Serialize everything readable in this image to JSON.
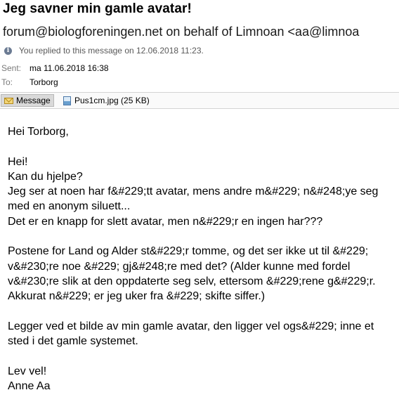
{
  "subject": "Jeg savner min gamle avatar!",
  "from": "forum@biologforeningen.net on behalf of Limnoan <aa@limnoa",
  "reply_notice": "You replied to this message on 12.06.2018 11:23.",
  "meta": {
    "sent_label": "Sent:",
    "sent_value": "ma 11.06.2018 16:38",
    "to_label": "To:",
    "to_value": "Torborg"
  },
  "attachments": {
    "message_tab": "Message",
    "file": "Pus1cm.jpg (25 KB)"
  },
  "body": {
    "greeting": "Hei Torborg,",
    "paragraph1": "Hei!\nKan du hjelpe?\nJeg ser at noen har f&#229;tt avatar, mens andre m&#229; n&#248;ye seg\nmed en anonym siluett...\nDet er en knapp for slett avatar, men n&#229;r en ingen har???",
    "paragraph2": "Postene for Land og Alder st&#229;r tomme, og det ser ikke ut til &#229;\nv&#230;re noe &#229; gj&#248;re med det? (Alder kunne med fordel\nv&#230;re slik at den oppdaterte seg selv, ettersom &#229;rene g&#229;r.\nAkkurat n&#229; er jeg uker fra &#229; skifte siffer.)",
    "paragraph3": "Legger ved et bilde av min gamle avatar, den ligger vel ogs&#229; inne et\nsted i det gamle systemet.",
    "closing": "Lev vel!\nAnne Aa"
  }
}
